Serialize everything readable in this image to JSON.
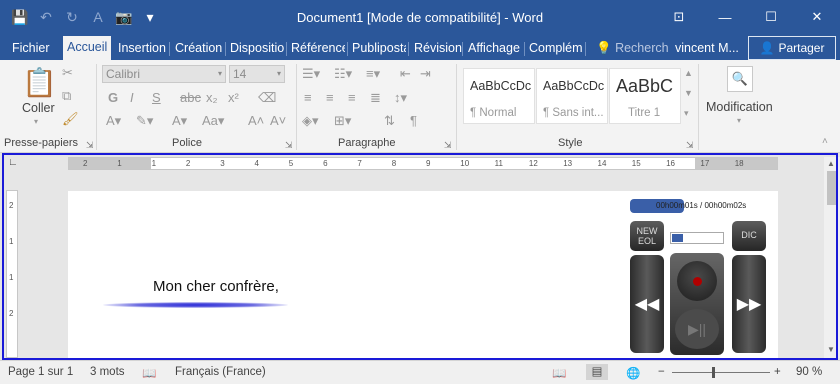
{
  "window": {
    "title": "Document1 [Mode de compatibilité] - Word",
    "controls": {
      "ribbon_options": "⊡",
      "minimize": "—",
      "maximize": "☐",
      "close": "✕"
    }
  },
  "qat": {
    "save": "💾",
    "undo": "↶",
    "redo": "↻",
    "format_painter": "A",
    "camera": "📷",
    "more": "▾"
  },
  "tabs": [
    "Fichier",
    "Accueil",
    "Insertion",
    "Création",
    "Dispositio",
    "Référence",
    "Publiposta",
    "Révision",
    "Affichage",
    "Complém"
  ],
  "tell_me": "Recherch",
  "user": "vincent M...",
  "share": "Partager",
  "ribbon": {
    "clipboard": {
      "label": "Presse-papiers",
      "paste": "Coller"
    },
    "font": {
      "label": "Police",
      "name": "Calibri",
      "size": "14"
    },
    "paragraph": {
      "label": "Paragraphe"
    },
    "styles": {
      "label": "Style",
      "items": [
        {
          "sample": "AaBbCcDc",
          "name": "¶ Normal"
        },
        {
          "sample": "AaBbCcDc",
          "name": "¶ Sans int..."
        },
        {
          "sample": "AaBbC",
          "name": "Titre 1"
        }
      ]
    },
    "editing": {
      "label": "Modification"
    }
  },
  "ruler": {
    "ticks": [
      "2",
      "1",
      "1",
      "2",
      "3",
      "4",
      "5",
      "6",
      "7",
      "8",
      "9",
      "10",
      "11",
      "12",
      "13",
      "14",
      "15",
      "16",
      "17",
      "18"
    ]
  },
  "vruler": {
    "ticks": [
      "2",
      "1",
      "1",
      "2"
    ]
  },
  "document": {
    "text": "Mon cher confrère,"
  },
  "dictation": {
    "timer": "00h00m01s / 00h00m02s",
    "new_label": "NEW\nEOL",
    "dic_label": "DIC",
    "progress": 0.22,
    "rewind": "◀◀",
    "forward": "▶▶",
    "play": "▶||"
  },
  "status": {
    "page": "Page 1 sur 1",
    "words": "3 mots",
    "language": "Français (France)",
    "zoom": "90 %",
    "zoom_minus": "−",
    "zoom_plus": "+"
  }
}
